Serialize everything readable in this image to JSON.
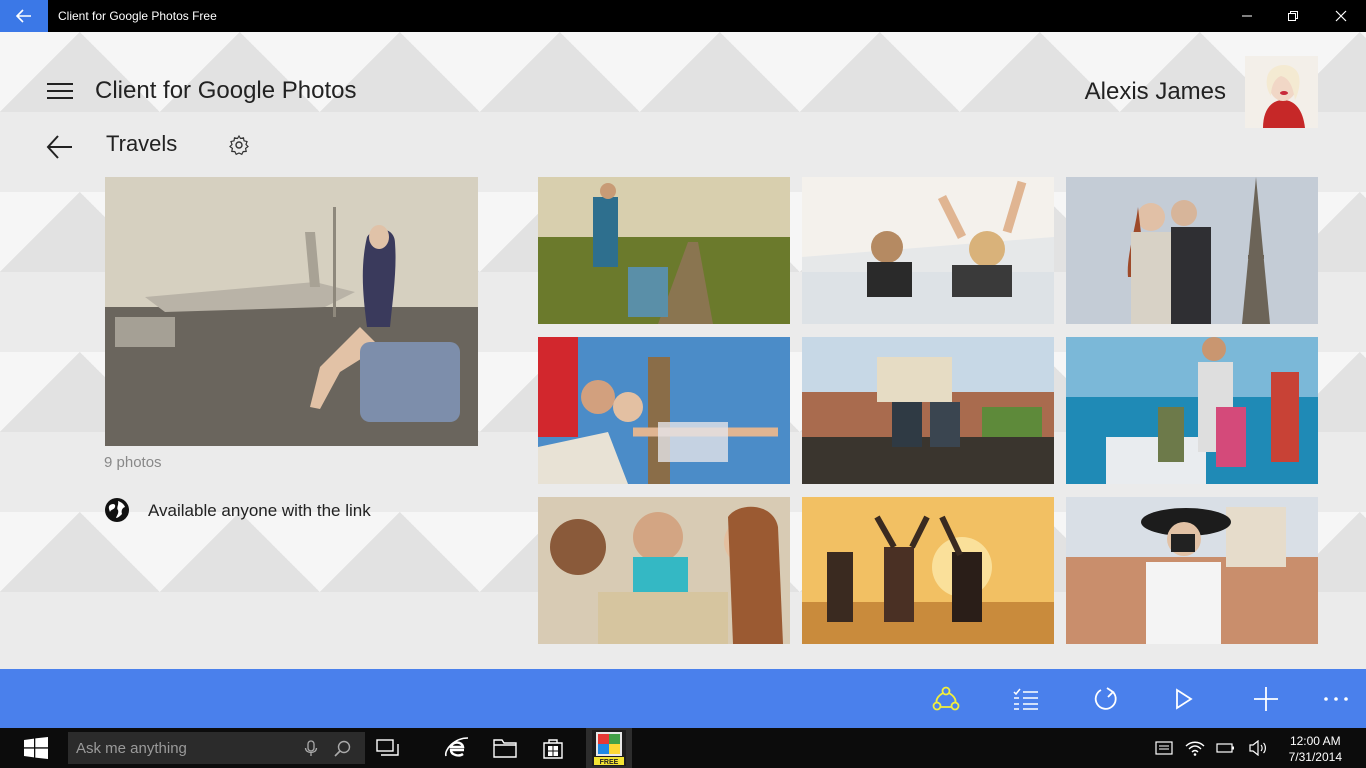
{
  "window": {
    "title": "Client for Google Photos Free"
  },
  "header": {
    "app_title": "Client for Google Photos",
    "user_name": "Alexis  James"
  },
  "album": {
    "title": "Travels",
    "photo_count": "9 photos",
    "sharing": "Available anyone with the link"
  },
  "photos": [
    {
      "desc": "Hikers on dirt road"
    },
    {
      "desc": "Couple in convertible"
    },
    {
      "desc": "Couple at Eiffel Tower"
    },
    {
      "desc": "Friends pointing at Big Ben"
    },
    {
      "desc": "Friends with map on roof"
    },
    {
      "desc": "Family on beach"
    },
    {
      "desc": "Friends reading map"
    },
    {
      "desc": "Friends dancing at sunset"
    },
    {
      "desc": "Woman with camera"
    }
  ],
  "appbar": {
    "buttons": [
      "share-icon",
      "select-icon",
      "refresh-icon",
      "play-icon",
      "add-icon",
      "more-icon"
    ],
    "accent": "#4a80ec",
    "share_color": "#f3ef3a"
  },
  "taskbar": {
    "search_placeholder": "Ask me anything",
    "app_badge": "FREE",
    "time": "12:00 AM",
    "date": "7/31/2014"
  }
}
